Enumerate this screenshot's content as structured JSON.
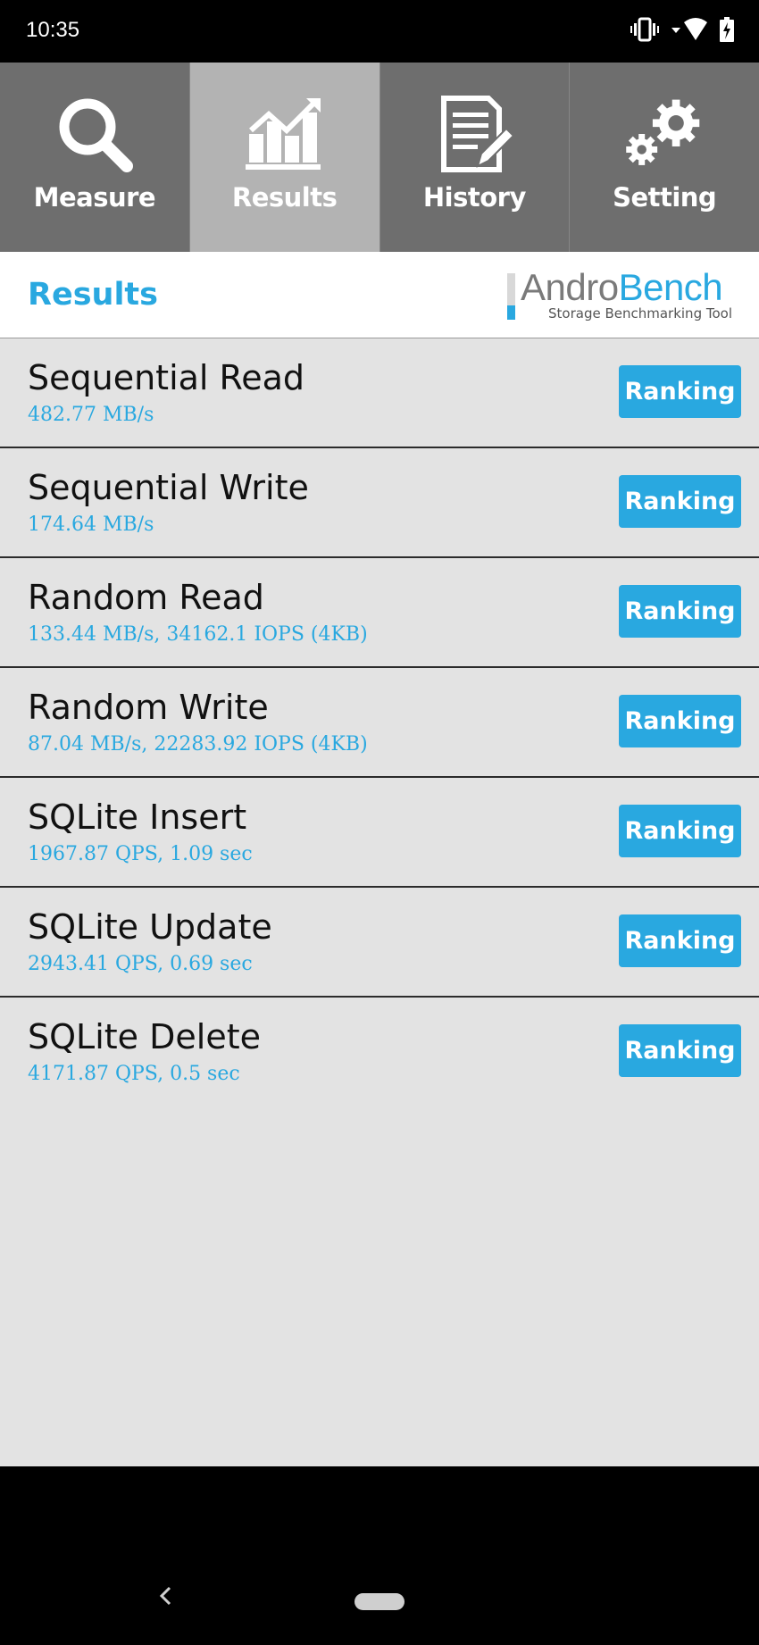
{
  "status_bar": {
    "time": "10:35",
    "icons": [
      "vibrate-icon",
      "wifi-icon",
      "battery-charging-icon"
    ]
  },
  "tabs": [
    {
      "label": "Measure",
      "icon": "magnifier-icon",
      "active": false
    },
    {
      "label": "Results",
      "icon": "bar-chart-icon",
      "active": true
    },
    {
      "label": "History",
      "icon": "document-pen-icon",
      "active": false
    },
    {
      "label": "Setting",
      "icon": "gears-icon",
      "active": false
    }
  ],
  "header": {
    "title": "Results",
    "logo_part1": "Andro",
    "logo_part2": "Bench",
    "logo_tagline": "Storage Benchmarking Tool"
  },
  "results": [
    {
      "name": "Sequential Read",
      "value": "482.77 MB/s",
      "button": "Ranking"
    },
    {
      "name": "Sequential Write",
      "value": "174.64 MB/s",
      "button": "Ranking"
    },
    {
      "name": "Random Read",
      "value": "133.44 MB/s, 34162.1 IOPS (4KB)",
      "button": "Ranking"
    },
    {
      "name": "Random Write",
      "value": "87.04 MB/s, 22283.92 IOPS (4KB)",
      "button": "Ranking"
    },
    {
      "name": "SQLite Insert",
      "value": "1967.87 QPS, 1.09 sec",
      "button": "Ranking"
    },
    {
      "name": "SQLite Update",
      "value": "2943.41 QPS, 0.69 sec",
      "button": "Ranking"
    },
    {
      "name": "SQLite Delete",
      "value": "4171.87 QPS, 0.5 sec",
      "button": "Ranking"
    }
  ],
  "colors": {
    "accent": "#29a8e0",
    "tab_bg": "#6e6e6e",
    "tab_active_bg": "#b3b3b3",
    "list_bg": "#e3e3e3"
  },
  "nav": {
    "back_icon": "back-chevron-icon",
    "home_icon": "home-pill-icon"
  }
}
